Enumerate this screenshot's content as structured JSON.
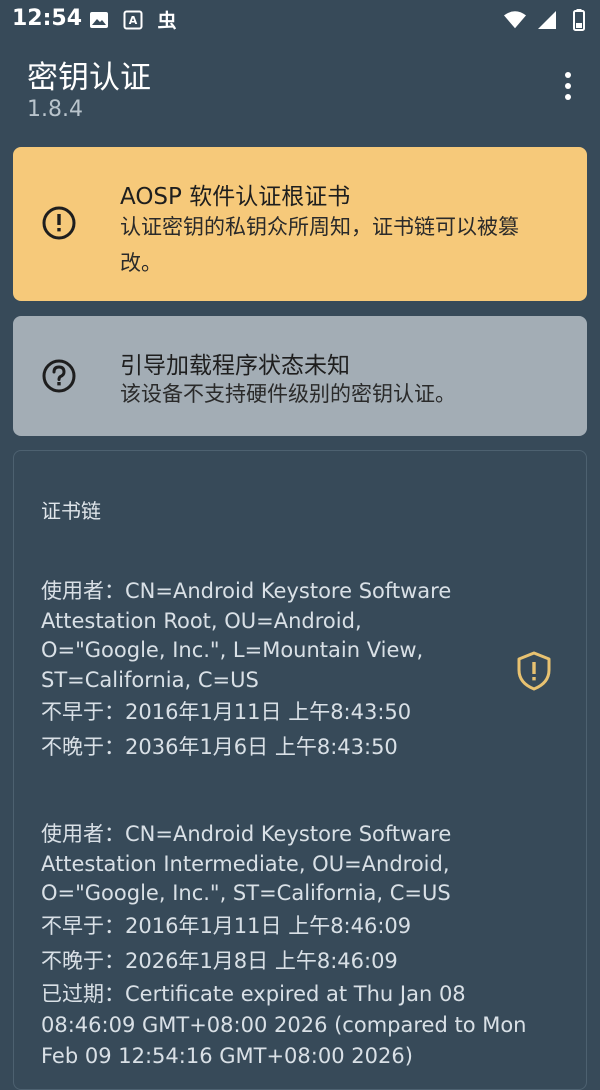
{
  "status_bar": {
    "time": "12:54",
    "left_icons": [
      "image-icon",
      "keyboard-a-icon",
      "bug-icon"
    ],
    "right_icons": [
      "wifi-icon",
      "cellular-signal-icon",
      "battery-icon"
    ]
  },
  "app_bar": {
    "title": "密钥认证",
    "version": "1.8.4",
    "menu_icon": "more-vert-icon"
  },
  "warning_card": {
    "icon": "exclamation-circle-icon",
    "title": "AOSP 软件认证根证书",
    "description": "认证密钥的私钥众所周知，证书链可以被篡改。",
    "color": "#f6c97a"
  },
  "unknown_card": {
    "icon": "question-circle-icon",
    "title": "引导加载程序状态未知",
    "description": "该设备不支持硬件级别的密钥认证。",
    "color": "#a3adb5"
  },
  "chain": {
    "title": "证书链",
    "certificates": [
      {
        "subject": "使用者：CN=Android Keystore Software Attestation Root, OU=Android, O=\"Google, Inc.\", L=Mountain View, ST=California, C=US",
        "not_before": "不早于：2016年1月11日 上午8:43:50",
        "not_after": "不晚于：2036年1月6日 上午8:43:50",
        "badge_icon": "shield-warning-icon",
        "badge_color": "#e8c271"
      },
      {
        "subject": "使用者：CN=Android Keystore Software Attestation Intermediate, OU=Android, O=\"Google, Inc.\", ST=California, C=US",
        "not_before": "不早于：2016年1月11日 上午8:46:09",
        "not_after": "不晚于：2026年1月8日 上午8:46:09",
        "expired": "已过期：Certificate expired at Thu Jan 08 08:46:09 GMT+08:00 2026 (compared to Mon Feb 09 12:54:16 GMT+08:00 2026)"
      }
    ]
  },
  "colors": {
    "background": "#374a59",
    "card_border": "#4d6170"
  }
}
